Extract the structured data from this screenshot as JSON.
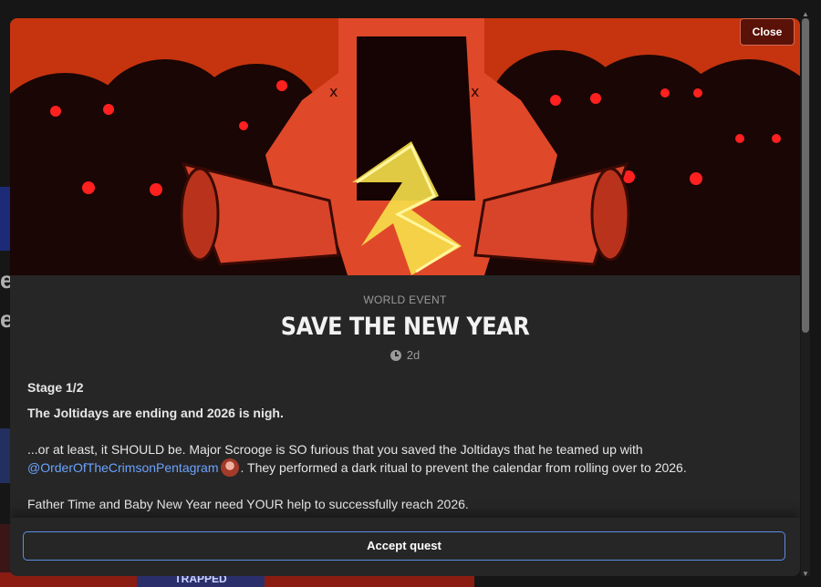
{
  "modal": {
    "close_label": "Close",
    "eyebrow": "WORLD EVENT",
    "title": "SAVE THE NEW YEAR",
    "time_icon": "clock-icon",
    "time_ago": "2d",
    "stage": "Stage 1/2",
    "lead": "The Joltidays are ending and 2026 is nigh.",
    "para1_start": "...or at least, it SHOULD be. Major Scrooge is SO furious that you saved the Joltidays that he teamed up with",
    "mention": "@OrderOfTheCrimsonPentagram",
    "para1_end": ". They performed a dark ritual to prevent the calendar from rolling over to 2026.",
    "para2": "Father Time and Baby New Year need YOUR help to successfully reach 2026.",
    "accept_label": "Accept quest"
  },
  "background": {
    "glyph_1": "e",
    "glyph_2": "e",
    "banner_text": "TRAPPED"
  },
  "colors": {
    "accent_blue": "#5b8ee6",
    "mention_blue": "#6aa3ff",
    "close_bg": "#5a1208",
    "banner_red": "#c23312"
  }
}
